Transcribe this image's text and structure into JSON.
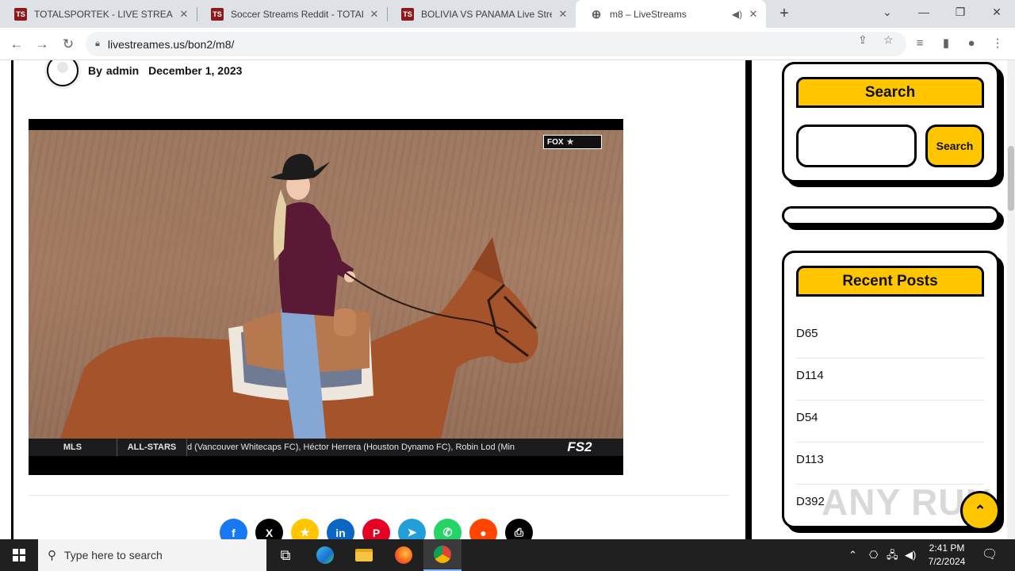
{
  "browser": {
    "tabs": [
      {
        "favicon": "TS",
        "title": "TOTALSPORTEK - LIVE STREAMS"
      },
      {
        "favicon": "TS",
        "title": "Soccer Streams Reddit - TOTALSP"
      },
      {
        "favicon": "TS",
        "title": "BOLIVIA VS PANAMA Live Strean"
      },
      {
        "favicon": "globe-icon",
        "title": "m8 – LiveStreams"
      }
    ],
    "url": "livestreames.us/bon2/m8/"
  },
  "article": {
    "by_label": "By",
    "author": "admin",
    "date": "December 1, 2023"
  },
  "video": {
    "logo_text": "FOX",
    "ticker": {
      "league": "MLS",
      "segment": "ALL-STARS",
      "text": "d (Vancouver Whitecaps FC), Héctor Herrera (Houston Dynamo FC), Robin Lod (Min",
      "channel": "FS2"
    }
  },
  "share_buttons": [
    {
      "name": "facebook",
      "glyph": "f",
      "color": "#1877f2"
    },
    {
      "name": "x",
      "glyph": "X",
      "color": "#000000"
    },
    {
      "name": "bookmark",
      "glyph": "★",
      "color": "#ffc600"
    },
    {
      "name": "linkedin",
      "glyph": "in",
      "color": "#0a66c2"
    },
    {
      "name": "pinterest",
      "glyph": "P",
      "color": "#e60023"
    },
    {
      "name": "telegram",
      "glyph": "➤",
      "color": "#229ed9"
    },
    {
      "name": "whatsapp",
      "glyph": "✆",
      "color": "#25d366"
    },
    {
      "name": "reddit",
      "glyph": "●",
      "color": "#ff4500"
    },
    {
      "name": "print",
      "glyph": "⎙",
      "color": "#000000"
    }
  ],
  "sidebar": {
    "search_title": "Search",
    "search_button": "Search",
    "search_value": "",
    "recent_title": "Recent Posts",
    "recent_posts": [
      "D65",
      "D114",
      "D54",
      "D113",
      "D392"
    ]
  },
  "watermark": "ANY RUN",
  "taskbar": {
    "search_placeholder": "Type here to search",
    "time": "2:41 PM",
    "date": "7/2/2024"
  },
  "colors": {
    "accent": "#ffc600",
    "border": "#000000"
  }
}
